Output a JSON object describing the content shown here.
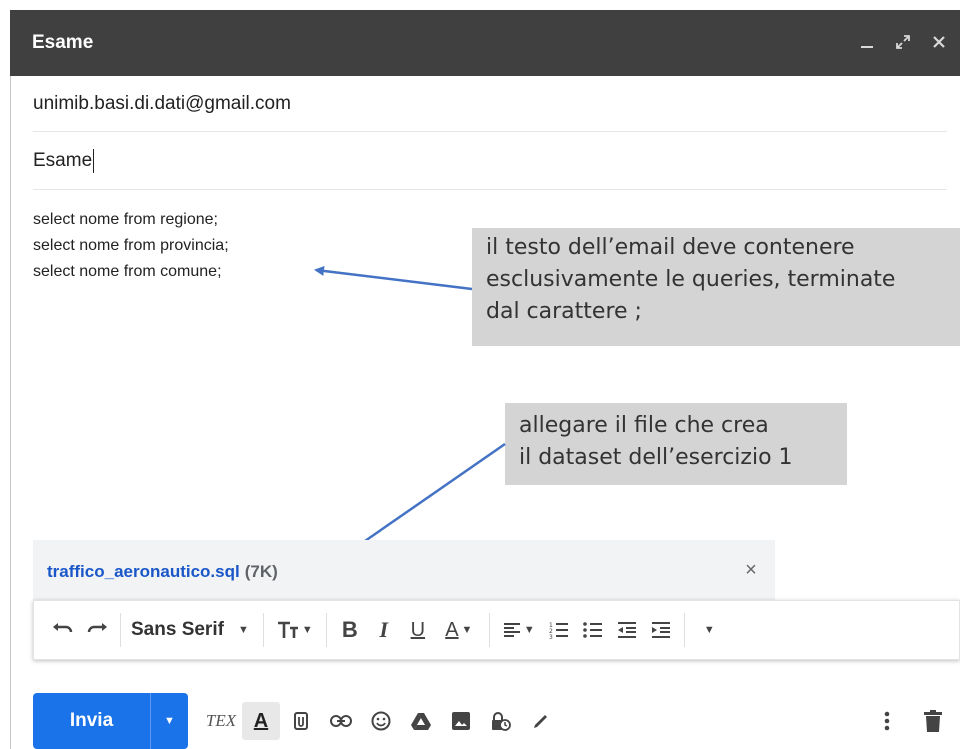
{
  "window": {
    "title": "Esame",
    "controls": [
      "minimize-icon",
      "expand-icon",
      "close-icon"
    ]
  },
  "to": {
    "value": "unimib.basi.di.dati@gmail.com"
  },
  "subject": {
    "value": "Esame"
  },
  "body": {
    "lines": [
      "select nome from regione;",
      "select nome from provincia;",
      "select nome from comune;"
    ]
  },
  "notes": [
    {
      "lines": [
        "il testo dell’email deve contenere",
        "esclusivamente le queries, terminate",
        "dal carattere ;"
      ]
    },
    {
      "lines": [
        "allegare il file che crea",
        "il dataset dell’esercizio 1"
      ]
    }
  ],
  "attachment": {
    "name": "traffico_aeronautico.sql",
    "size": "(7K)"
  },
  "format_bar": {
    "font": "Sans Serif",
    "icons": [
      "undo-icon",
      "redo-icon",
      "font-size-icon",
      "bold-icon",
      "italic-icon",
      "underline-icon",
      "text-color-icon",
      "align-icon",
      "numbered-list-icon",
      "bulleted-list-icon",
      "indent-less-icon",
      "indent-more-icon",
      "more-formatting-icon"
    ],
    "glyphs": {
      "bold": "B",
      "italic": "I",
      "underline": "U",
      "text_color": "A"
    }
  },
  "bottom_bar": {
    "send_label": "Invia",
    "tex_label": "TEX",
    "format_toggle_glyph": "A",
    "icons": [
      "formatting-options-icon",
      "attach-icon",
      "link-icon",
      "emoji-icon",
      "drive-icon",
      "photo-icon",
      "confidential-mode-icon",
      "signature-icon",
      "more-options-icon",
      "delete-icon"
    ]
  },
  "colors": {
    "titlebar": "#404040",
    "send_button": "#1a73e8",
    "attachment_link": "#1a57c9",
    "note_background": "#d4d4d4",
    "arrow": "#4472c4"
  }
}
